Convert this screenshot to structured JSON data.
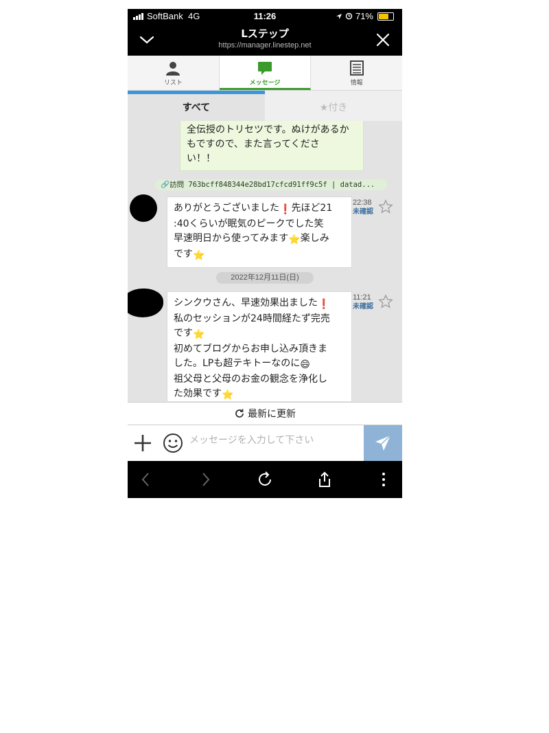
{
  "status_bar": {
    "carrier": "SoftBank",
    "network": "4G",
    "time": "11:26",
    "battery": "71%"
  },
  "header": {
    "title": "Lステップ",
    "url": "https://manager.linestep.net",
    "collapse_icon": "chevron-down-icon",
    "close_icon": "close-icon"
  },
  "tabs": [
    {
      "label": "リスト",
      "icon": "person-icon",
      "active": false
    },
    {
      "label": "メッセージ",
      "icon": "chat-bubble-icon",
      "active": true
    },
    {
      "label": "情報",
      "icon": "list-doc-icon",
      "active": false
    }
  ],
  "subtabs": [
    {
      "label": "すべて",
      "active": true
    },
    {
      "label": "★付き",
      "active": false
    }
  ],
  "messages": {
    "outgoing_lines": [
      "全伝授のトリセツです。ぬけがあるか",
      "もですので、また言ってくださ",
      "い！！"
    ],
    "visit_link": "🔗訪問 763bcff848344e28bd17cfcd91ff9c5f | datad...",
    "msg1": {
      "lines": [
        "ありがとうございました",
        "❗",
        "先ほど21",
        ":40くらいが眠気のピークでした笑",
        "早速明日から使ってみます",
        "⭐",
        "楽しみ",
        "です",
        "⭐"
      ],
      "time": "22:38",
      "status": "未確認"
    },
    "date_divider": "2022年12月11日(日)",
    "msg2": {
      "lines": [
        "シンクウさん、早速効果出ました",
        "❗",
        "私のセッションが24時間経たず完売",
        "です",
        "⭐",
        "初めてブログからお申し込み頂きま",
        "した。LPも超テキトーなのに",
        "😄",
        "祖父母と父母のお金の観念を浄化し",
        "た効果です",
        "⭐"
      ],
      "time": "11:21",
      "status": "未確認"
    }
  },
  "refresh_label": "最新に更新",
  "input": {
    "placeholder": "メッセージを入力して下さい",
    "value": ""
  },
  "colors": {
    "accent_green": "#3a9a2c",
    "accent_blue": "#3a96d8",
    "send_button": "#8fb3d6"
  }
}
